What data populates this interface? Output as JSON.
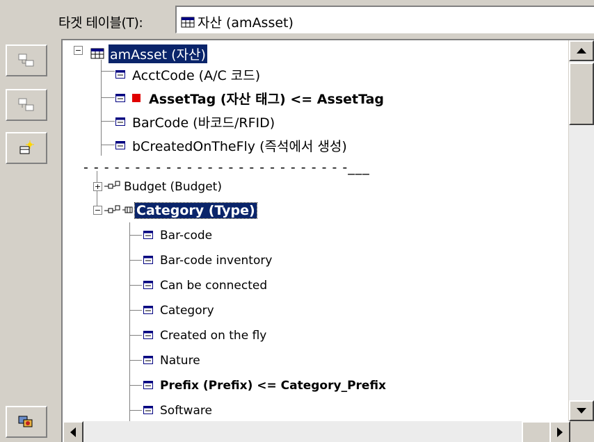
{
  "target_table": {
    "label": "타겟 테이블(T):",
    "value": "자산 (amAsset)"
  },
  "toolbar": {
    "buttons": [
      {
        "icon": "link-tables-icon"
      },
      {
        "icon": "unlink-tables-icon"
      },
      {
        "icon": "new-field-icon"
      },
      {
        "icon": "options-icon"
      }
    ]
  },
  "tree": {
    "root": {
      "label": "amAsset (자산)"
    },
    "fields_top": [
      {
        "label": "AcctCode (A/C 코드)",
        "bold": false
      },
      {
        "label": "AssetTag (자산 태그)  <=  AssetTag",
        "bold": true,
        "mapped": true
      },
      {
        "label": "BarCode (바코드/RFID)",
        "bold": false
      },
      {
        "label": "bCreatedOnTheFly (즉석에서 생성)",
        "bold": false
      }
    ],
    "separator": "- - - - - - - - - - - - - - - - - - - - - - - - - -___",
    "links": [
      {
        "label": "Budget (Budget)",
        "expanded": false
      },
      {
        "label": "Category (Type)",
        "expanded": true
      }
    ],
    "category_fields": [
      {
        "label": "Bar-code",
        "bold": false
      },
      {
        "label": "Bar-code inventory",
        "bold": false
      },
      {
        "label": "Can be connected",
        "bold": false
      },
      {
        "label": "Category",
        "bold": false
      },
      {
        "label": "Created on the fly",
        "bold": false
      },
      {
        "label": "Nature",
        "bold": false
      },
      {
        "label": "Prefix (Prefix)  <=  Category_Prefix",
        "bold": true
      },
      {
        "label": "Software",
        "bold": false
      }
    ]
  },
  "colors": {
    "selection": "#0a246a",
    "mapped_marker": "#e00000",
    "window_bg": "#d4d0c8"
  }
}
